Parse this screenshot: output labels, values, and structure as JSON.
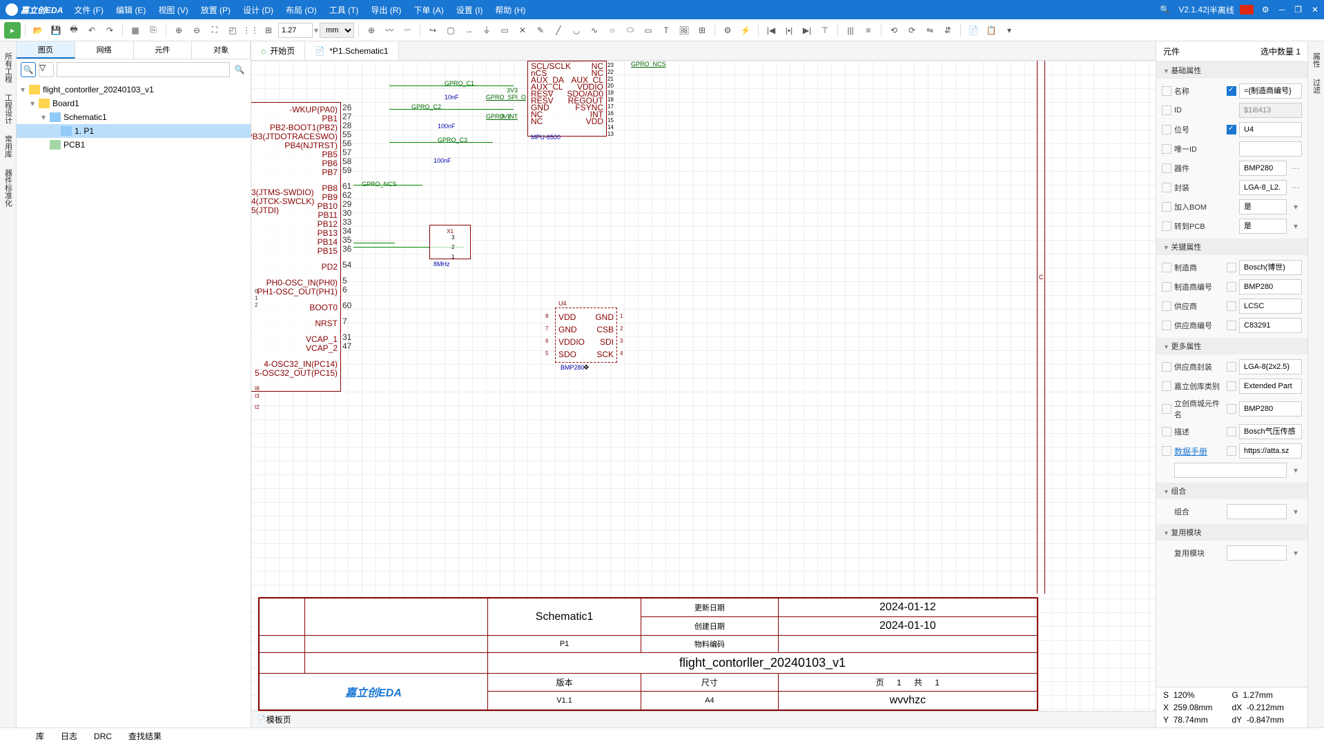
{
  "menubar": {
    "logo": "嘉立创EDA",
    "items": [
      "文件 (F)",
      "编辑 (E)",
      "视图 (V)",
      "放置 (P)",
      "设计 (D)",
      "布局 (O)",
      "工具 (T)",
      "导出 (R)",
      "下单 (A)",
      "设置 (I)",
      "帮助 (H)"
    ],
    "version": "V2.1.42",
    "mode": "半离线"
  },
  "toolbar": {
    "zoom": "1.27",
    "unit": "mm"
  },
  "leftVTabs": [
    "所有工程",
    "工程设计",
    "常用库",
    "器件标准化"
  ],
  "leftPanel": {
    "tabs": [
      "图页",
      "网络",
      "元件",
      "对象"
    ],
    "tree": {
      "root": "flight_contorller_20240103_v1",
      "board": "Board1",
      "schematic": "Schematic1",
      "page": "1. P1",
      "pcb": "PCB1"
    }
  },
  "centerTabs": {
    "home": "开始页",
    "current": "*P1.Schematic1"
  },
  "titleBlock": {
    "schematic": "Schematic1",
    "sheet": "P1",
    "project": "flight_contorller_20240103_v1",
    "updateLabel": "更新日期",
    "updateDate": "2024-01-12",
    "createLabel": "创建日期",
    "createDate": "2024-01-10",
    "partCodeLabel": "物料编码",
    "versionLabel": "版本",
    "sizeLabel": "尺寸",
    "pageLabel": "页",
    "totalLabel": "共",
    "version": "V1.1",
    "size": "A4",
    "page": "1",
    "total": "1",
    "author": "wvvhzc",
    "brand": "嘉立创EDA"
  },
  "bottomTab": "模板页",
  "schematic": {
    "mcu_pins": [
      "PA0",
      "PB1",
      "PB2",
      "PB3",
      "PB4",
      "PB5",
      "PB6",
      "PB7",
      "PB8",
      "PB9",
      "PB10",
      "PB11",
      "PB12",
      "PB13",
      "PB14",
      "PB15",
      "PD2",
      "PH0",
      "PH1",
      "BOOT0",
      "NRST",
      "VCAP_1",
      "VCAP_2"
    ],
    "nets": [
      "GPRO_C1",
      "GPRO_C2",
      "GPRO_C3",
      "GPRO_NCS",
      "GPRO_SPI_O",
      "GPRO_INT",
      "3V3"
    ],
    "caps": [
      "10nF",
      "100nF",
      "100nF"
    ],
    "u4": {
      "ref": "U4",
      "name": "BMP280",
      "pins_left": [
        "VDD",
        "GND",
        "VDDIO",
        "SDO"
      ],
      "pins_right": [
        "GND",
        "CSB",
        "SDI",
        "SCK"
      ]
    },
    "mpu": "MPU-6500",
    "xtal": "8MHz",
    "mpu_pins": [
      "SCL/SCLK",
      "nCS",
      "AUX_DA",
      "AUX_CL",
      "VDDIO",
      "SDO/AD0",
      "REGOUT",
      "FSYNC",
      "INT",
      "VDD",
      "NC",
      "NC",
      "NC",
      "NC",
      "NC",
      "RESV",
      "RESV",
      "GND",
      "NC",
      "NC",
      "NC"
    ],
    "wkup": "-WKUP(PA0)",
    "boot1": "PB2-BOOT1(PB2)",
    "jtdo": "PB3(JTDOTRACESWO)",
    "njtrst": "PB4(NJTRST)",
    "jtms": "3(JTMS-SWDIO)",
    "jtck": "4(JTCK-SWCLK)",
    "jtdi": "5(JTDI)",
    "osc_in": "PH0-OSC_IN(PH0)",
    "osc_out": "PH1-OSC_OUT(PH1)",
    "osc32_in": "4-OSC32_IN(PC14)",
    "osc32_out": "5-OSC32_OUT(PC15)"
  },
  "rightPanel": {
    "title": "元件",
    "selCount": "选中数量   1",
    "sections": {
      "basic": "基础属性",
      "key": "关键属性",
      "more": "更多属性",
      "group": "组合",
      "reuse": "复用模块"
    },
    "basic": {
      "nameLabel": "名称",
      "nameVal": "={制造商编号}",
      "idLabel": "ID",
      "idVal": "$1i6413",
      "refLabel": "位号",
      "refVal": "U4",
      "uidLabel": "唯一ID",
      "uidVal": "",
      "deviceLabel": "器件",
      "deviceVal": "BMP280",
      "packageLabel": "封装",
      "packageVal": "LGA-8_L2.",
      "bomLabel": "加入BOM",
      "bomVal": "是",
      "pcbLabel": "转到PCB",
      "pcbVal": "是"
    },
    "key": {
      "mfrLabel": "制造商",
      "mfrVal": "Bosch(博世)",
      "mfrPnLabel": "制造商编号",
      "mfrPnVal": "BMP280",
      "supLabel": "供应商",
      "supVal": "LCSC",
      "supPnLabel": "供应商编号",
      "supPnVal": "C83291"
    },
    "more": {
      "supPkgLabel": "供应商封装",
      "supPkgVal": "LGA-8(2x2.5)",
      "jlcCatLabel": "嘉立创库类别",
      "jlcCatVal": "Extended Part",
      "lcscNameLabel": "立创商城元件名",
      "lcscNameVal": "BMP280",
      "descLabel": "描述",
      "descVal": "Bosch气压传感",
      "dsLabel": "数据手册",
      "dsVal": "https://atta.sz"
    },
    "groupLabel": "组合",
    "reuseLabel": "复用模块"
  },
  "rightVTabs": [
    "属性",
    "过滤"
  ],
  "status": {
    "s": "S",
    "sVal": "120%",
    "g": "G",
    "gVal": "1.27mm",
    "x": "X",
    "xVal": "259.08mm",
    "dx": "dX",
    "dxVal": "-0.212mm",
    "y": "Y",
    "yVal": "78.74mm",
    "dy": "dY",
    "dyVal": "-0.847mm"
  },
  "statusbar": [
    "库",
    "日志",
    "DRC",
    "查找结果"
  ]
}
